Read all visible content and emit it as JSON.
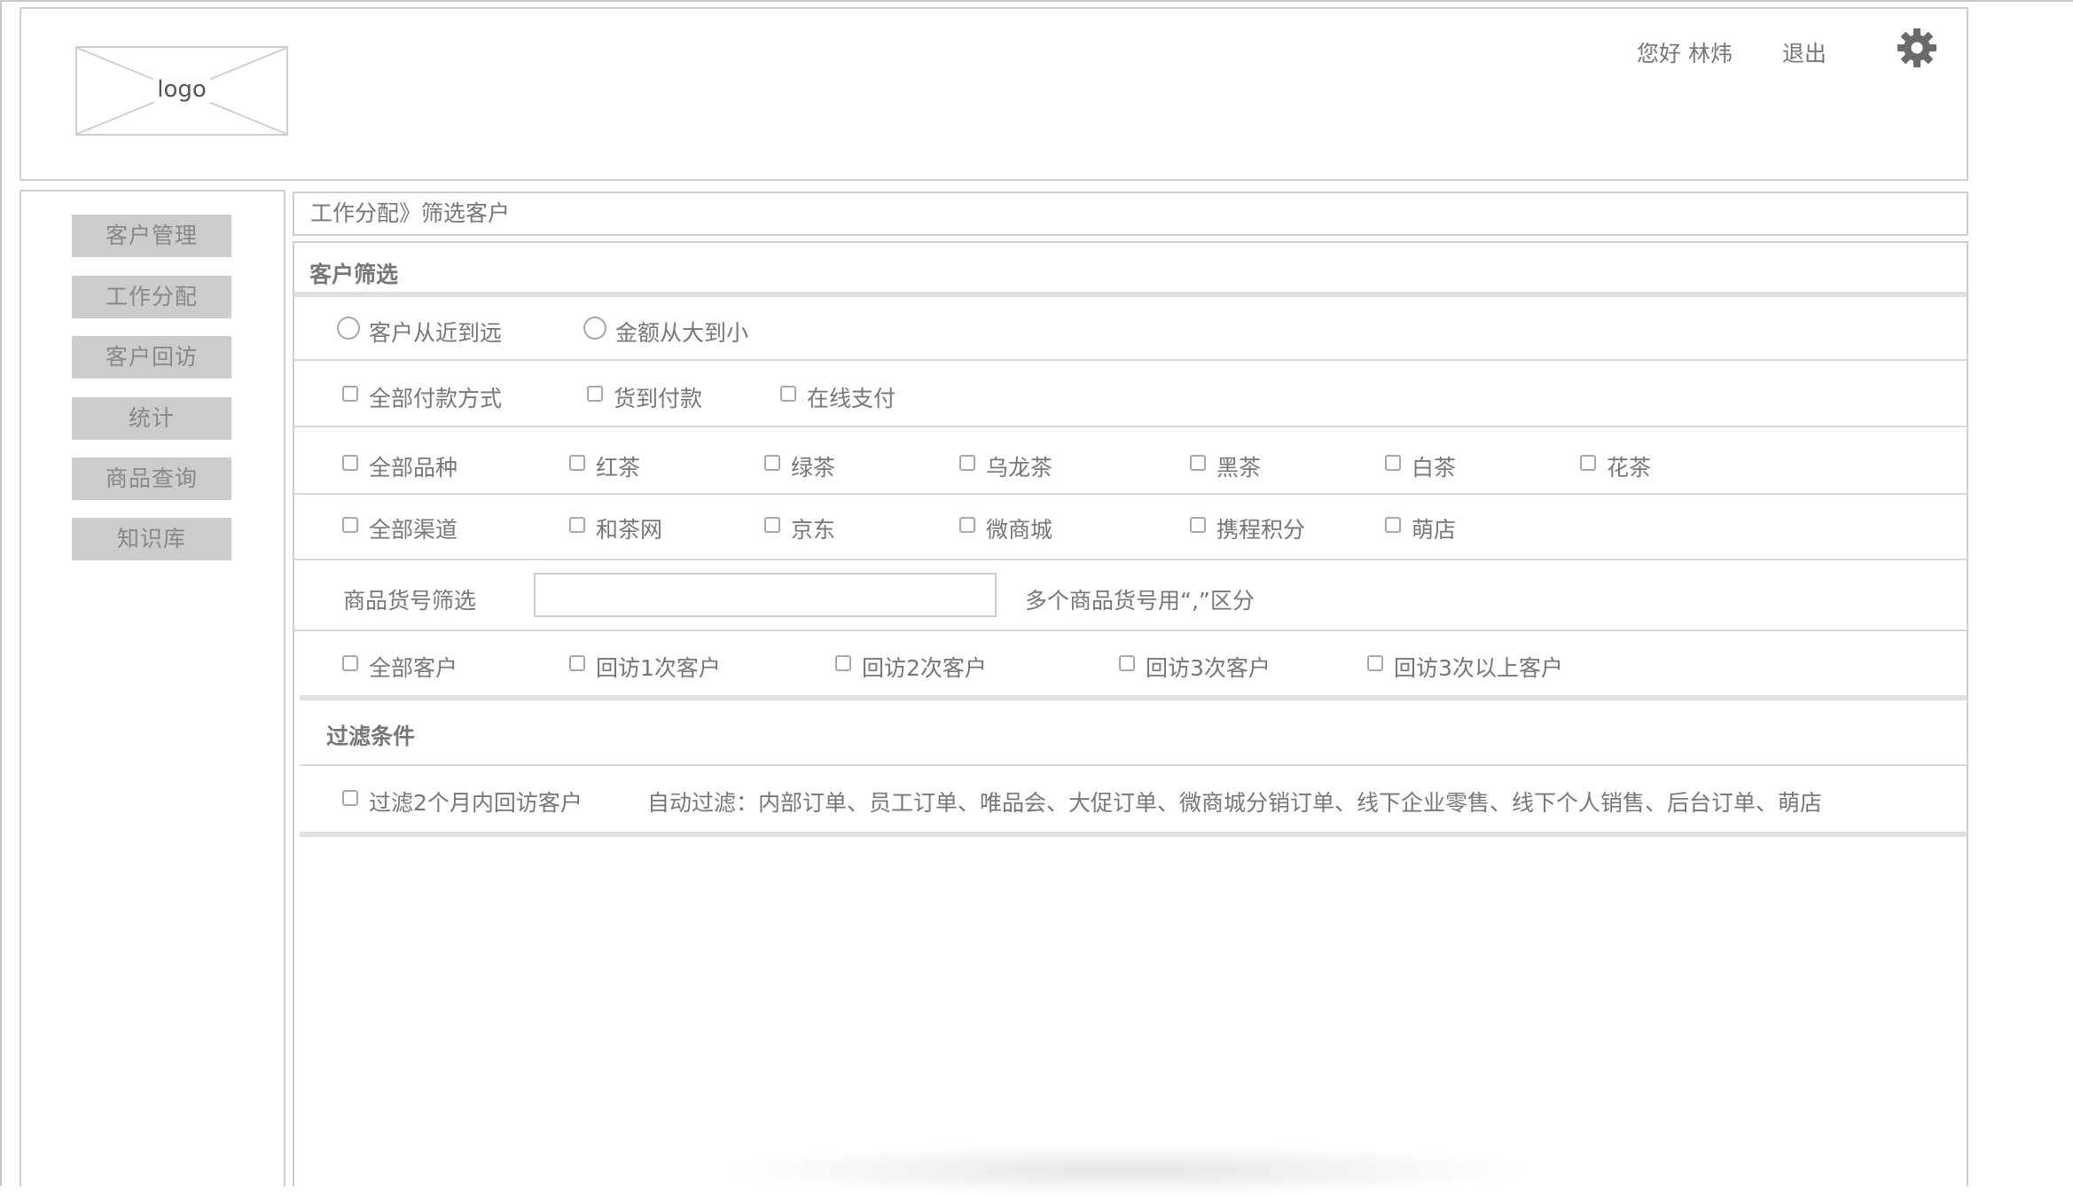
{
  "header": {
    "logo_text": "logo",
    "greeting": "您好 林炜",
    "logout_label": "退出",
    "settings_icon": "gear-icon"
  },
  "sidebar": {
    "items": [
      {
        "label": "客户管理"
      },
      {
        "label": "工作分配"
      },
      {
        "label": "客户回访"
      },
      {
        "label": "统计"
      },
      {
        "label": "商品查询"
      },
      {
        "label": "知识库"
      }
    ]
  },
  "breadcrumb": "工作分配》筛选客户",
  "filter": {
    "title": "客户筛选",
    "sort_options": [
      "客户从近到远",
      "金额从大到小"
    ],
    "payment_options": [
      "全部付款方式",
      "货到付款",
      "在线支付"
    ],
    "variety_options": [
      "全部品种",
      "红茶",
      "绿茶",
      "乌龙茶",
      "黑茶",
      "白茶",
      "花茶"
    ],
    "channel_options": [
      "全部渠道",
      "和茶网",
      "京东",
      "微商城",
      "携程积分",
      "萌店"
    ],
    "sku_label": "商品货号筛选",
    "sku_value": "",
    "sku_hint": "多个商品货号用“,”区分",
    "visit_options": [
      "全部客户",
      "回访1次客户",
      "回访2次客户",
      "回访3次客户",
      "回访3次以上客户"
    ]
  },
  "conditions": {
    "title": "过滤条件",
    "filter_recent_label": "过滤2个月内回访客户",
    "auto_filter_text": "自动过滤：内部订单、员工订单、唯品会、大促订单、微商城分销订单、线下企业零售、线下个人销售、后台订单、萌店"
  }
}
